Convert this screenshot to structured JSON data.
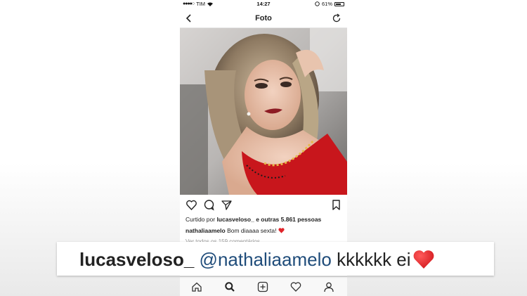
{
  "status_bar": {
    "carrier": "TIM",
    "time": "14:27",
    "battery": "61%"
  },
  "nav": {
    "title": "Foto"
  },
  "post": {
    "liked_prefix": "Curtido por",
    "liked_user": "lucasveloso_",
    "liked_suffix": "e outras 5.861 pessoas",
    "caption_user": "nathaliaamelo",
    "caption_text": "Bom diaaaa sexta!",
    "view_comments": "Ver todos os 159 comentários"
  },
  "banner": {
    "user": "lucasveloso_",
    "mention": "@nathaliaamelo",
    "text": "kkkkkk ei"
  },
  "icons": [
    "back-icon",
    "refresh-icon",
    "heart-icon",
    "comment-icon",
    "share-icon",
    "bookmark-icon",
    "home-icon",
    "search-icon",
    "add-icon",
    "activity-icon",
    "profile-icon"
  ],
  "colors": {
    "heart_red": "#e0242a",
    "mention_blue": "#1f4c7a",
    "dress_red": "#c8161c"
  }
}
